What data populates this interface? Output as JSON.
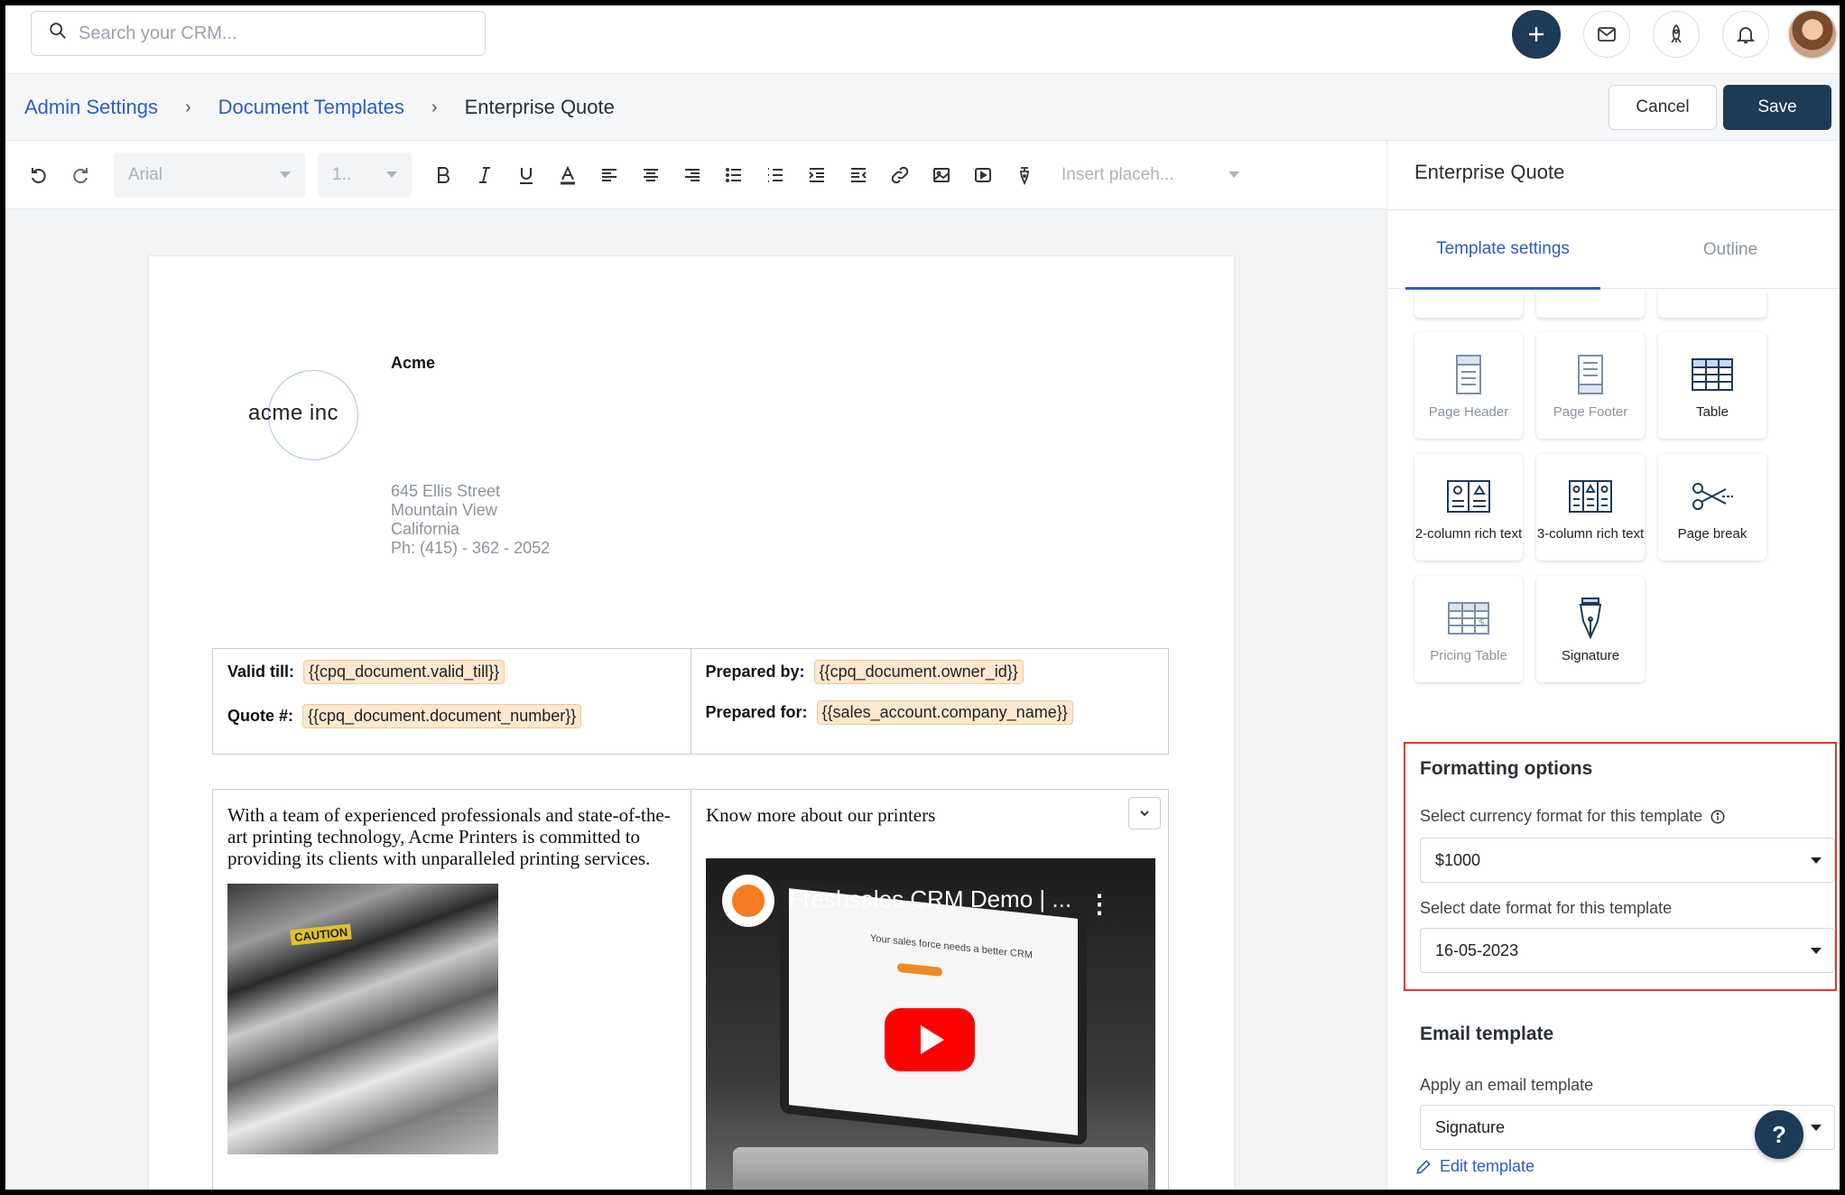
{
  "search": {
    "placeholder": "Search your CRM..."
  },
  "breadcrumb": {
    "items": [
      "Admin Settings",
      "Document Templates"
    ],
    "current": "Enterprise Quote"
  },
  "header": {
    "cancel_label": "Cancel",
    "save_label": "Save"
  },
  "toolbar": {
    "font": "Arial",
    "size": "1..",
    "placeholder_label": "Insert placeh..."
  },
  "document": {
    "company": "Acme",
    "logo_text": "acme inc",
    "address": [
      "645 Ellis Street",
      "Mountain View",
      "California",
      "Ph: (415) - 362 - 2052"
    ],
    "info": {
      "valid_till_label": "Valid till:",
      "valid_till_value": "{{cpq_document.valid_till}}",
      "quote_label": "Quote #:",
      "quote_value": "{{cpq_document.document_number}}",
      "prepared_by_label": "Prepared by:",
      "prepared_by_value": "{{cpq_document.owner_id}}",
      "prepared_for_label": "Prepared for:",
      "prepared_for_value": "{{sales_account.company_name}}"
    },
    "left_text": "With a team of experienced professionals and state-of-the-art printing technology, Acme Printers is committed to providing its clients with unparalleled printing services.",
    "image_caution": "CAUTION",
    "right_heading": "Know more about our printers",
    "video_title": "Freshsales CRM Demo | ...",
    "video_hero": "Your sales force needs a better CRM"
  },
  "panel": {
    "title": "Enterprise Quote",
    "tabs": [
      "Template settings",
      "Outline"
    ],
    "blocks": [
      {
        "label": "Page Header",
        "icon": "page-header-icon",
        "enabled": false
      },
      {
        "label": "Page Footer",
        "icon": "page-footer-icon",
        "enabled": false
      },
      {
        "label": "Table",
        "icon": "table-icon",
        "enabled": true
      },
      {
        "label": "2-column rich text",
        "icon": "two-column-icon",
        "enabled": true
      },
      {
        "label": "3-column rich text",
        "icon": "three-column-icon",
        "enabled": true
      },
      {
        "label": "Page break",
        "icon": "scissors-icon",
        "enabled": true
      },
      {
        "label": "Pricing Table",
        "icon": "pricing-table-icon",
        "enabled": false
      },
      {
        "label": "Signature",
        "icon": "pen-nib-icon",
        "enabled": true
      }
    ],
    "formatting": {
      "title": "Formatting options",
      "currency_label": "Select currency format for this template",
      "currency_value": "$1000",
      "date_label": "Select date format for this template",
      "date_value": "16-05-2023"
    },
    "email": {
      "title": "Email template",
      "apply_label": "Apply an email template",
      "value": "Signature",
      "edit_label": "Edit template"
    }
  },
  "help": {
    "label": "?"
  },
  "colors": {
    "primary": "#1d3a57",
    "link": "#2c5cc5",
    "highlight_border": "#e0372a",
    "tag_bg": "#fde7cf"
  }
}
